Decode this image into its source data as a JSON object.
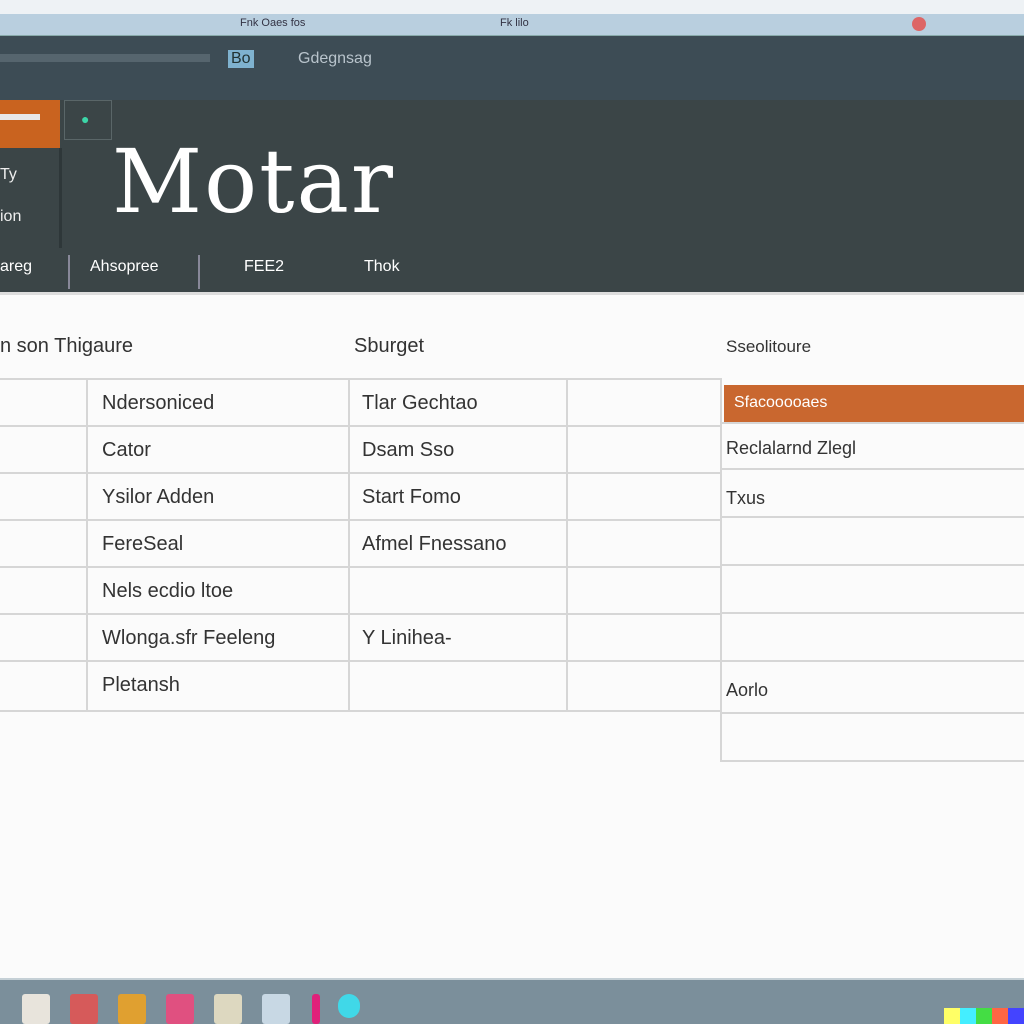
{
  "tabbar": {
    "tabs": [
      "Fnk Oaes fos",
      "Fk lilo"
    ]
  },
  "toolbar": {
    "address": "Bo",
    "label": "Gdegnsag"
  },
  "header": {
    "title": "Motar",
    "side_items": [
      "Ty",
      "ion"
    ],
    "nav": [
      "areg",
      "Ahsopree",
      "FEE2",
      "Thok"
    ]
  },
  "table": {
    "headers": [
      "n son Thigaure",
      "Sburget",
      "Sseolitoure"
    ],
    "col1": [
      "Ndersoniced",
      "Cator",
      "Ysilor Adden",
      "FereSeal",
      "Nels ecdio ltoe",
      "Wlonga.sfr Feeleng",
      "Pletansh"
    ],
    "col2": [
      "Tlar Gechtao",
      "Dsam Sso",
      "Start Fomo",
      "Afmel Fnessano",
      "",
      "Y Linihea-",
      ""
    ],
    "right": [
      "Sfacooooaes",
      "Reclalarnd Zlegl",
      "Txus",
      "",
      "",
      "",
      "Aorlo"
    ]
  },
  "selected_row_color": "#c9672f",
  "taskbar": {
    "icons": [
      "file-icon",
      "paint-icon",
      "photo-icon",
      "flower-icon",
      "chart-icon",
      "window-icon",
      "pin-icon",
      "globe-icon"
    ]
  }
}
